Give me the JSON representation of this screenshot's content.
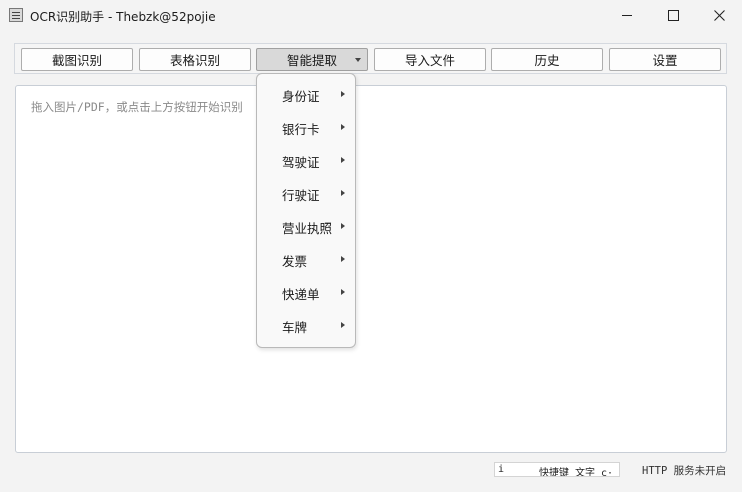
{
  "window": {
    "title": "OCR识别助手 - Thebzk@52pojie",
    "controls": {
      "minimize": "minimize-icon",
      "maximize": "maximize-icon",
      "close": "close-icon"
    }
  },
  "toolbar": {
    "buttons": [
      {
        "label": "截图识别"
      },
      {
        "label": "表格识别"
      },
      {
        "label": "智能提取",
        "state": "open",
        "has_dropdown": true
      },
      {
        "label": "导入文件"
      },
      {
        "label": "历史"
      },
      {
        "label": "设置"
      }
    ]
  },
  "main": {
    "placeholder": "拖入图片/PDF，或点击上方按钮开始识别"
  },
  "dropdown_menu": {
    "items": [
      {
        "label": "身份证",
        "has_submenu": true
      },
      {
        "label": "银行卡",
        "has_submenu": true
      },
      {
        "label": "驾驶证",
        "has_submenu": true
      },
      {
        "label": "行驶证",
        "has_submenu": true
      },
      {
        "label": "营业执照",
        "has_submenu": true
      },
      {
        "label": "发票",
        "has_submenu": true
      },
      {
        "label": "快递单",
        "has_submenu": true
      },
      {
        "label": "车牌",
        "has_submenu": true
      }
    ]
  },
  "statusbar": {
    "hotkey_field_value": "i",
    "hotkey_field_hint": "快捷键  文字 c·",
    "http_status": "HTTP 服务未开启"
  }
}
